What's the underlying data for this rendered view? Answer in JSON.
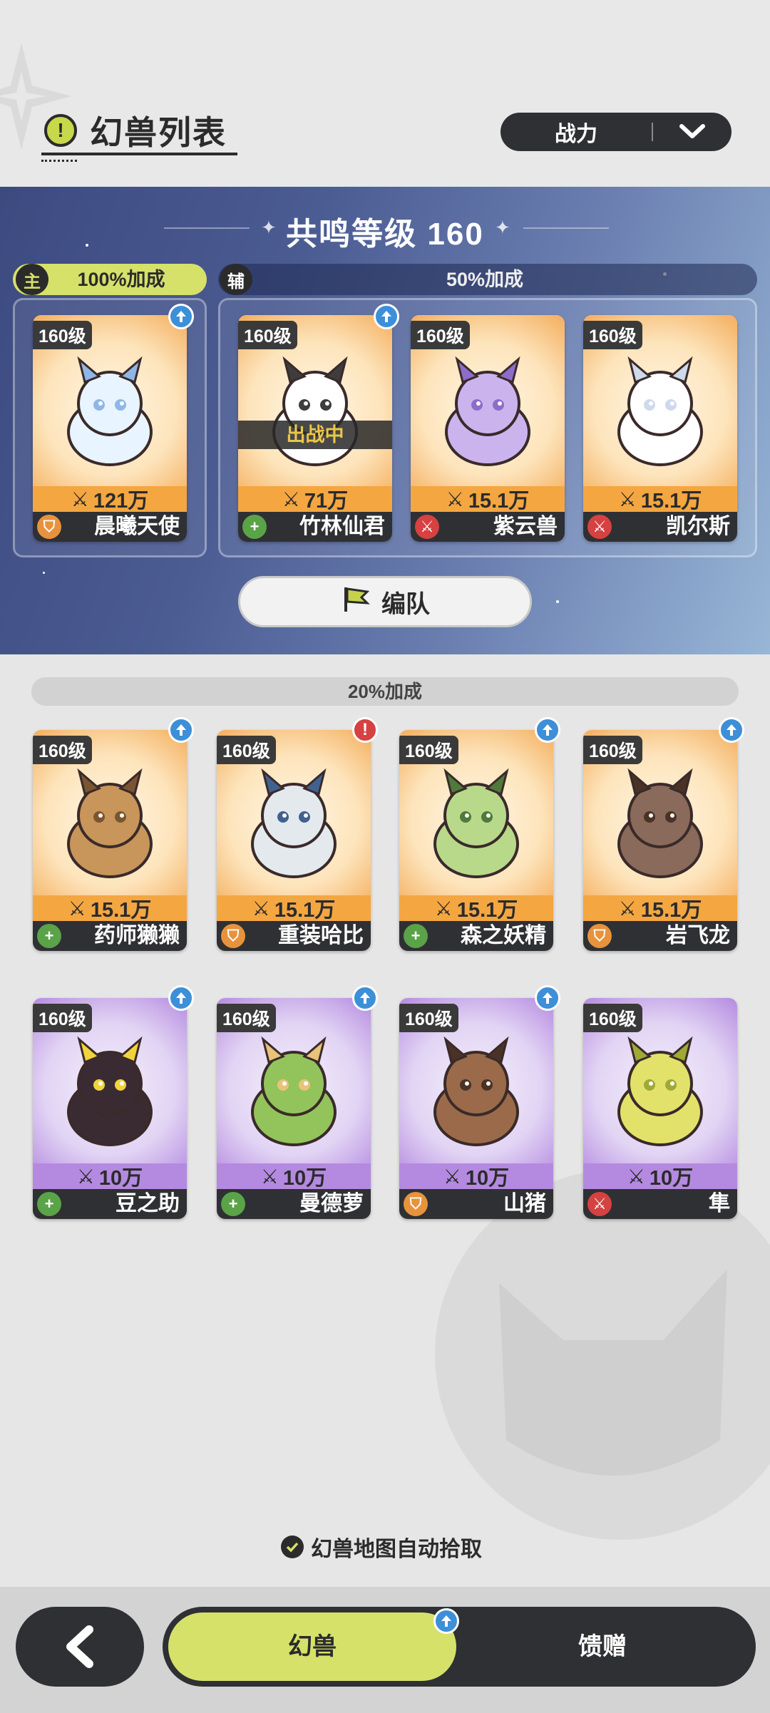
{
  "header": {
    "title": "幻兽列表",
    "title_icon": "exclamation-icon",
    "sort_label": "战力",
    "sort_icon": "chevron-down-icon"
  },
  "resonance": {
    "title": "共鸣等级 160",
    "main_tag": "主",
    "main_bonus": "100%加成",
    "sub_tag": "辅",
    "sub_bonus": "50%加成"
  },
  "team_cards": [
    {
      "level": "160级",
      "power": "121万",
      "name": "晨曦天使",
      "role": "shield",
      "theme": "orange",
      "badge": "up"
    },
    {
      "level": "160级",
      "power": "71万",
      "name": "竹林仙君",
      "role": "heal",
      "theme": "orange",
      "badge": "up",
      "status": "出战中"
    },
    {
      "level": "160级",
      "power": "15.1万",
      "name": "紫云兽",
      "role": "attack",
      "theme": "orange",
      "badge": ""
    },
    {
      "level": "160级",
      "power": "15.1万",
      "name": "凯尔斯",
      "role": "attack",
      "theme": "orange",
      "badge": ""
    }
  ],
  "formation_button": {
    "label": "编队",
    "icon": "flag-icon"
  },
  "list_section": {
    "bonus": "20%加成"
  },
  "list_cards": [
    {
      "level": "160级",
      "power": "15.1万",
      "name": "药师獭獭",
      "role": "heal",
      "theme": "orange",
      "badge": "up"
    },
    {
      "level": "160级",
      "power": "15.1万",
      "name": "重装哈比",
      "role": "shield",
      "theme": "orange",
      "badge": "warn"
    },
    {
      "level": "160级",
      "power": "15.1万",
      "name": "森之妖精",
      "role": "heal",
      "theme": "orange",
      "badge": "up"
    },
    {
      "level": "160级",
      "power": "15.1万",
      "name": "岩飞龙",
      "role": "shield",
      "theme": "orange",
      "badge": "up"
    },
    {
      "level": "160级",
      "power": "10万",
      "name": "豆之助",
      "role": "heal",
      "theme": "purple",
      "badge": "up"
    },
    {
      "level": "160级",
      "power": "10万",
      "name": "曼德萝",
      "role": "heal",
      "theme": "purple",
      "badge": "up"
    },
    {
      "level": "160级",
      "power": "10万",
      "name": "山猪",
      "role": "shield",
      "theme": "purple",
      "badge": "up"
    },
    {
      "level": "160级",
      "power": "10万",
      "name": "隼",
      "role": "attack",
      "theme": "purple",
      "badge": ""
    }
  ],
  "auto_pickup": {
    "label": "幻兽地图自动拾取",
    "checked": true
  },
  "bottom_nav": {
    "back_icon": "back-arrow-icon",
    "tab_active": "幻兽",
    "tab_inactive": "馈赠",
    "tab_badge": "up"
  },
  "colors": {
    "accent": "#d6e16a",
    "dark": "#2f3033",
    "shield": "#e7933d",
    "heal": "#5aa348",
    "attack": "#d64141",
    "upgrade": "#3d8fd8"
  }
}
